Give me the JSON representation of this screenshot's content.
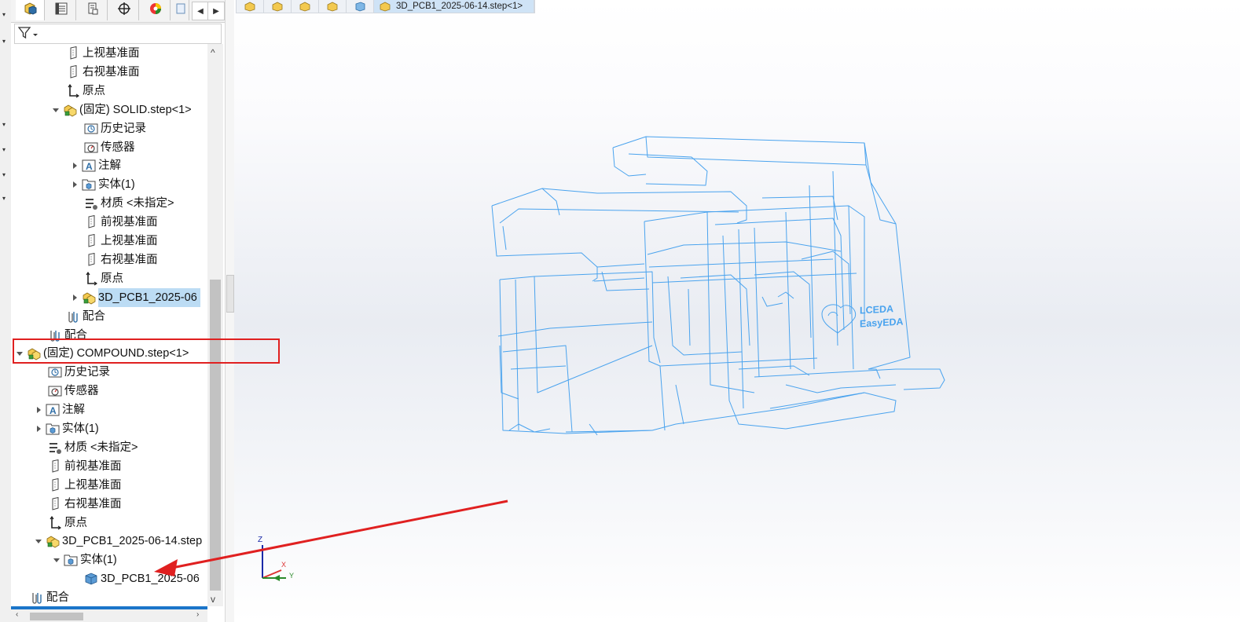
{
  "panel_tabs": [
    {
      "name": "feature-manager-tab-icon",
      "active": true
    },
    {
      "name": "property-manager-tab-icon",
      "active": false
    },
    {
      "name": "configuration-manager-tab-icon",
      "active": false
    },
    {
      "name": "dimxpert-manager-tab-icon",
      "active": false
    },
    {
      "name": "display-manager-tab-icon",
      "active": false
    },
    {
      "name": "more-tabs-icon",
      "active": false
    }
  ],
  "filter": {
    "icon": "filter-icon"
  },
  "tree": [
    {
      "label": "上视基准面",
      "icon": "plane",
      "indent": 70,
      "twisty": "none"
    },
    {
      "label": "右视基准面",
      "icon": "plane",
      "indent": 70,
      "twisty": "none"
    },
    {
      "label": "原点",
      "icon": "origin",
      "indent": 70,
      "twisty": "none"
    },
    {
      "label": "(固定) SOLID.step<1>",
      "icon": "subassembly",
      "indent": 52,
      "twisty": "open"
    },
    {
      "label": "历史记录",
      "icon": "history",
      "indent": 93,
      "twisty": "none"
    },
    {
      "label": "传感器",
      "icon": "sensor",
      "indent": 93,
      "twisty": "none"
    },
    {
      "label": "注解",
      "icon": "annotation",
      "indent": 76,
      "twisty": "closed"
    },
    {
      "label": "实体(1)",
      "icon": "bodies",
      "indent": 76,
      "twisty": "closed"
    },
    {
      "label": "材质 <未指定>",
      "icon": "material",
      "indent": 93,
      "twisty": "none"
    },
    {
      "label": "前视基准面",
      "icon": "plane",
      "indent": 93,
      "twisty": "none"
    },
    {
      "label": "上视基准面",
      "icon": "plane",
      "indent": 93,
      "twisty": "none"
    },
    {
      "label": "右视基准面",
      "icon": "plane",
      "indent": 93,
      "twisty": "none"
    },
    {
      "label": "原点",
      "icon": "origin",
      "indent": 93,
      "twisty": "none"
    },
    {
      "label": "3D_PCB1_2025-06",
      "icon": "subassembly",
      "indent": 76,
      "twisty": "closed",
      "selected": true
    },
    {
      "label": "配合",
      "icon": "mates",
      "indent": 70,
      "twisty": "none"
    },
    {
      "label": "配合",
      "icon": "mates",
      "indent": 47,
      "twisty": "none"
    },
    {
      "label": "(固定) COMPOUND.step<1>",
      "icon": "subassembly",
      "indent": 6,
      "twisty": "open"
    },
    {
      "label": "历史记录",
      "icon": "history",
      "indent": 47,
      "twisty": "none"
    },
    {
      "label": "传感器",
      "icon": "sensor",
      "indent": 47,
      "twisty": "none"
    },
    {
      "label": "注解",
      "icon": "annotation",
      "indent": 30,
      "twisty": "closed"
    },
    {
      "label": "实体(1)",
      "icon": "bodies",
      "indent": 30,
      "twisty": "closed"
    },
    {
      "label": "材质 <未指定>",
      "icon": "material",
      "indent": 47,
      "twisty": "none"
    },
    {
      "label": "前视基准面",
      "icon": "plane",
      "indent": 47,
      "twisty": "none"
    },
    {
      "label": "上视基准面",
      "icon": "plane",
      "indent": 47,
      "twisty": "none"
    },
    {
      "label": "右视基准面",
      "icon": "plane",
      "indent": 47,
      "twisty": "none"
    },
    {
      "label": "原点",
      "icon": "origin",
      "indent": 47,
      "twisty": "none"
    },
    {
      "label": "3D_PCB1_2025-06-14.step",
      "icon": "subassembly",
      "indent": 30,
      "twisty": "open"
    },
    {
      "label": "实体(1)",
      "icon": "bodies",
      "indent": 53,
      "twisty": "open"
    },
    {
      "label": "3D_PCB1_2025-06",
      "icon": "solid-body",
      "indent": 93,
      "twisty": "none"
    },
    {
      "label": "配合",
      "icon": "mates",
      "indent": 24,
      "twisty": "none"
    }
  ],
  "breadcrumb": {
    "items": [
      "assembly-icon",
      "part-icon",
      "part-icon",
      "part-icon",
      "body-icon"
    ],
    "current": "3D_PCB1_2025-06-14.step<1>"
  },
  "viewport": {
    "logo_line1": "LCEDA",
    "logo_line2": "EasyEDA",
    "wire_color": "#4aa3ee",
    "triad": {
      "z": "Z",
      "x": "X",
      "y": "Y"
    }
  },
  "annotations": {
    "highlight_color": "#e02020",
    "arrow_color": "#e02020"
  }
}
